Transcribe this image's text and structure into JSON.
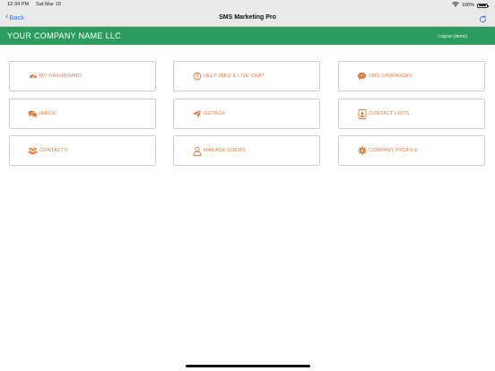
{
  "status_bar": {
    "time": "12:34 PM",
    "date": "Sat Mar 19",
    "battery": "100%",
    "icons": [
      "wifi-icon",
      "battery-icon"
    ]
  },
  "nav": {
    "back_label": "Back",
    "title": "SMS Marketing Pro",
    "icons": [
      "chevron-left-icon",
      "refresh-icon"
    ]
  },
  "header": {
    "company_name": "YOUR COMPANY NAME LLC",
    "logout_label": "Logout (demo)"
  },
  "menu": {
    "items": [
      {
        "label": "MY DASHBOARD",
        "icon": "dashboard-gauge-icon"
      },
      {
        "label": "HELP INFO & LIVE CHAT",
        "icon": "help-circle-icon"
      },
      {
        "label": "SMS CAMPAIGNS",
        "icon": "chat-bubble-icon"
      },
      {
        "label": "INBOX",
        "icon": "chat-bubbles-icon"
      },
      {
        "label": "OUTBOX",
        "icon": "paper-plane-icon"
      },
      {
        "label": "CONTACT LISTS",
        "icon": "contact-card-icon"
      },
      {
        "label": "CONTACTS",
        "icon": "users-group-icon"
      },
      {
        "label": "MANAGE USERS",
        "icon": "user-outline-icon"
      },
      {
        "label": "COMPANY PROFILE",
        "icon": "gear-icon"
      }
    ]
  },
  "colors": {
    "header_green": "#2c9b5e",
    "accent_orange": "#e07b3c",
    "ios_blue": "#2f7bf0"
  }
}
